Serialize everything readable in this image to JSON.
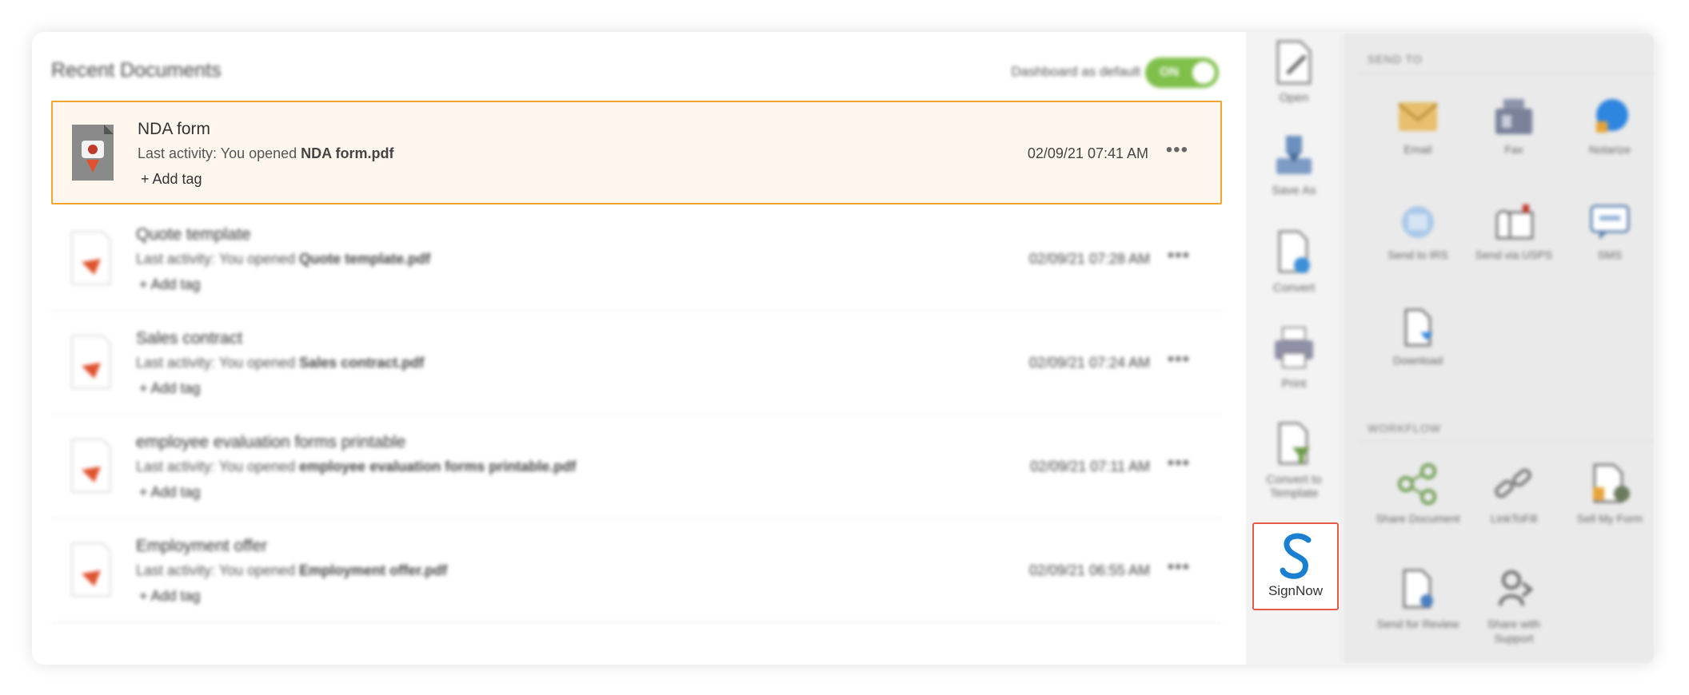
{
  "header": {
    "title": "Recent Documents",
    "default_label": "Dashboard as default",
    "toggle_label": "ON"
  },
  "documents": [
    {
      "name": "NDA form",
      "activity_prefix": "Last activity: You opened ",
      "file": "NDA form.pdf",
      "add_tag": "+ Add tag",
      "date": "02/09/21 07:41 AM",
      "more": "•••"
    },
    {
      "name": "Quote template",
      "activity_prefix": "Last activity: You opened ",
      "file": "Quote template.pdf",
      "add_tag": "+ Add tag",
      "date": "02/09/21 07:28 AM",
      "more": "•••"
    },
    {
      "name": "Sales contract",
      "activity_prefix": "Last activity: You opened ",
      "file": "Sales contract.pdf",
      "add_tag": "+ Add tag",
      "date": "02/09/21 07:24 AM",
      "more": "•••"
    },
    {
      "name": "employee evaluation forms printable",
      "activity_prefix": "Last activity: You opened ",
      "file": "employee evaluation forms printable.pdf",
      "add_tag": "+ Add tag",
      "date": "02/09/21 07:11 AM",
      "more": "•••"
    },
    {
      "name": "Employment offer",
      "activity_prefix": "Last activity: You opened ",
      "file": "Employment offer.pdf",
      "add_tag": "+ Add tag",
      "date": "02/09/21 06:55 AM",
      "more": "•••"
    }
  ],
  "toolbar": {
    "open": "Open",
    "save_as": "Save As",
    "convert": "Convert",
    "print": "Print",
    "convert_template": "Convert to Template",
    "signnow": "SignNow"
  },
  "panel": {
    "send_to_title": "SEND TO",
    "workflow_title": "WORKFLOW",
    "send_to": {
      "email": "Email",
      "fax": "Fax",
      "notarize": "Notarize",
      "irs": "Send to IRS",
      "usps": "Send via USPS",
      "sms": "SMS",
      "download": "Download"
    },
    "workflow": {
      "share": "Share Document",
      "linktofill": "LinkToFill",
      "sell": "Sell My Form",
      "review": "Send for Review",
      "support": "Share with Support"
    }
  },
  "colors": {
    "accent_orange": "#f4a430",
    "toggle_green": "#7fbf4a",
    "pdf_red": "#e0522f",
    "signnow_blue": "#1a7fd0",
    "signnow_border": "#e65a4a"
  }
}
